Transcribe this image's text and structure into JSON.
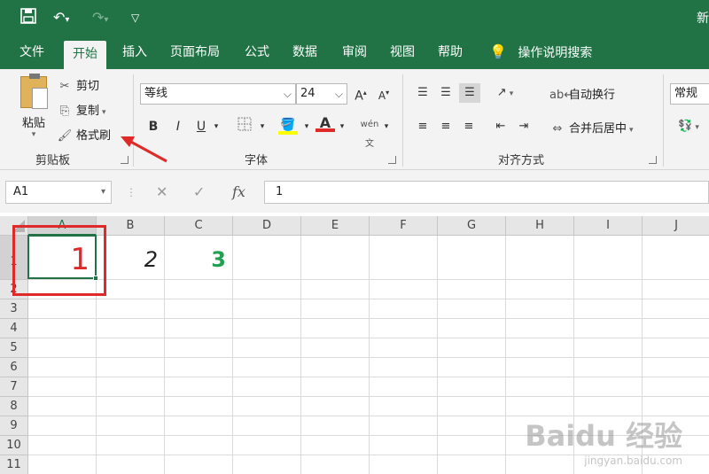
{
  "titlebar": {
    "save_icon": "save-icon",
    "undo_icon": "undo-icon",
    "redo_icon": "redo-icon",
    "customize_icon": "customize-qat-icon",
    "title_fragment": "新"
  },
  "tabs": [
    {
      "label": "文件"
    },
    {
      "label": "开始",
      "active": true
    },
    {
      "label": "插入"
    },
    {
      "label": "页面布局"
    },
    {
      "label": "公式"
    },
    {
      "label": "数据"
    },
    {
      "label": "审阅"
    },
    {
      "label": "视图"
    },
    {
      "label": "帮助"
    }
  ],
  "tell_me": {
    "label": "操作说明搜索",
    "icon": "lightbulb-icon"
  },
  "ribbon": {
    "clipboard": {
      "paste": "粘贴",
      "cut": "剪切",
      "copy": "复制",
      "format_painter": "格式刷",
      "group_label": "剪贴板"
    },
    "font": {
      "font_name": "等线",
      "font_size": "24",
      "bold": "B",
      "italic": "I",
      "underline": "U",
      "group_label": "字体",
      "fill_color": "#FFFF00",
      "font_color": "#E02A2A"
    },
    "alignment": {
      "wrap_text": "自动换行",
      "merge_center": "合并后居中",
      "group_label": "对齐方式"
    },
    "number": {
      "format": "常规"
    }
  },
  "formula_bar": {
    "name_box": "A1",
    "cancel_icon": "cancel-icon",
    "enter_icon": "check-icon",
    "fx": "fx",
    "content": "1"
  },
  "sheet": {
    "columns": [
      "A",
      "B",
      "C",
      "D",
      "E",
      "F",
      "G",
      "H",
      "I",
      "J"
    ],
    "rows": [
      "1",
      "2",
      "3",
      "4",
      "5",
      "6",
      "7",
      "8",
      "9",
      "10",
      "11"
    ],
    "cells": {
      "A1": {
        "value": "1",
        "color": "#E02A2A"
      },
      "B1": {
        "value": "2",
        "color": "#222222"
      },
      "C1": {
        "value": "3",
        "color": "#22A052"
      }
    },
    "selected": "A1"
  },
  "annotation": {
    "box_color": "#E02A2A",
    "arrow_color": "#E02A2A"
  },
  "watermark": {
    "main": "Baidu 经验",
    "url": "jingyan.baidu.com"
  }
}
